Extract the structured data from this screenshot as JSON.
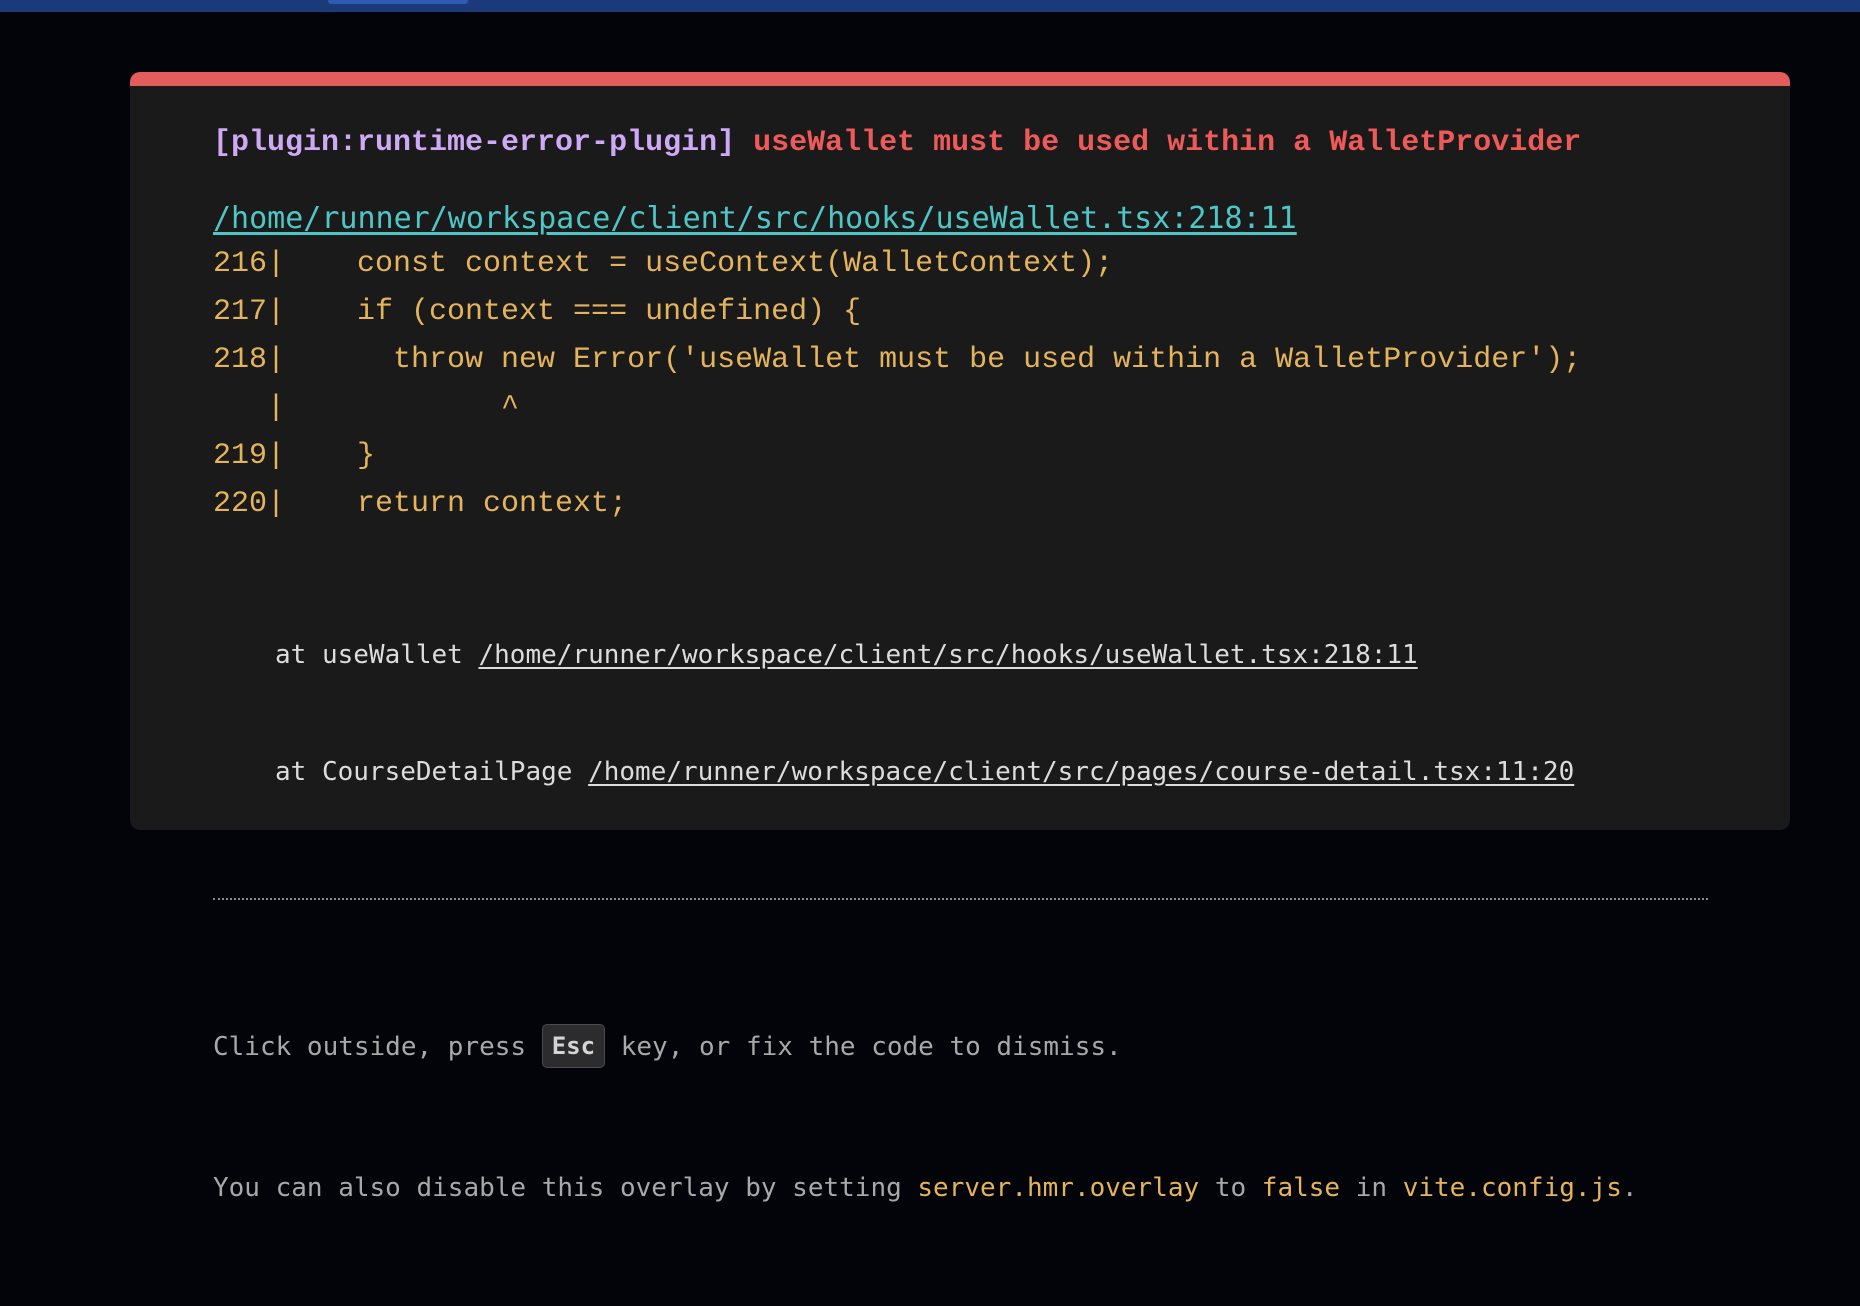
{
  "overlay": {
    "plugin_tag": "[plugin:runtime-error-plugin]",
    "error_message": " useWallet must be used within a WalletProvider",
    "file_link": "/home/runner/workspace/client/src/hooks/useWallet.tsx:218:11",
    "code_frame": [
      "216|    const context = useContext(WalletContext);",
      "217|    if (context === undefined) {",
      "218|      throw new Error('useWallet must be used within a WalletProvider');",
      "   |            ^",
      "219|    }",
      "220|    return context;"
    ],
    "stack": [
      {
        "prefix": "at useWallet ",
        "link": "/home/runner/workspace/client/src/hooks/useWallet.tsx:218:11"
      },
      {
        "prefix": "at CourseDetailPage ",
        "link": "/home/runner/workspace/client/src/pages/course-detail.tsx:11:20"
      }
    ],
    "tip": {
      "line1_before": "Click outside, press ",
      "key": "Esc",
      "line1_after": " key, or fix the code to dismiss.",
      "line2_part1": "You can also disable this overlay by setting ",
      "line2_code1": "server.hmr.overlay",
      "line2_part2": " to ",
      "line2_code2": "false",
      "line2_part3": " in ",
      "line2_code3": "vite.config.js",
      "line2_end": "."
    }
  },
  "colors": {
    "accent_bar": "#e35d5d",
    "plugin": "#cea9f5",
    "error_text": "#ee5a5a",
    "file_link": "#4fc6c6",
    "code": "#e4b45c"
  }
}
